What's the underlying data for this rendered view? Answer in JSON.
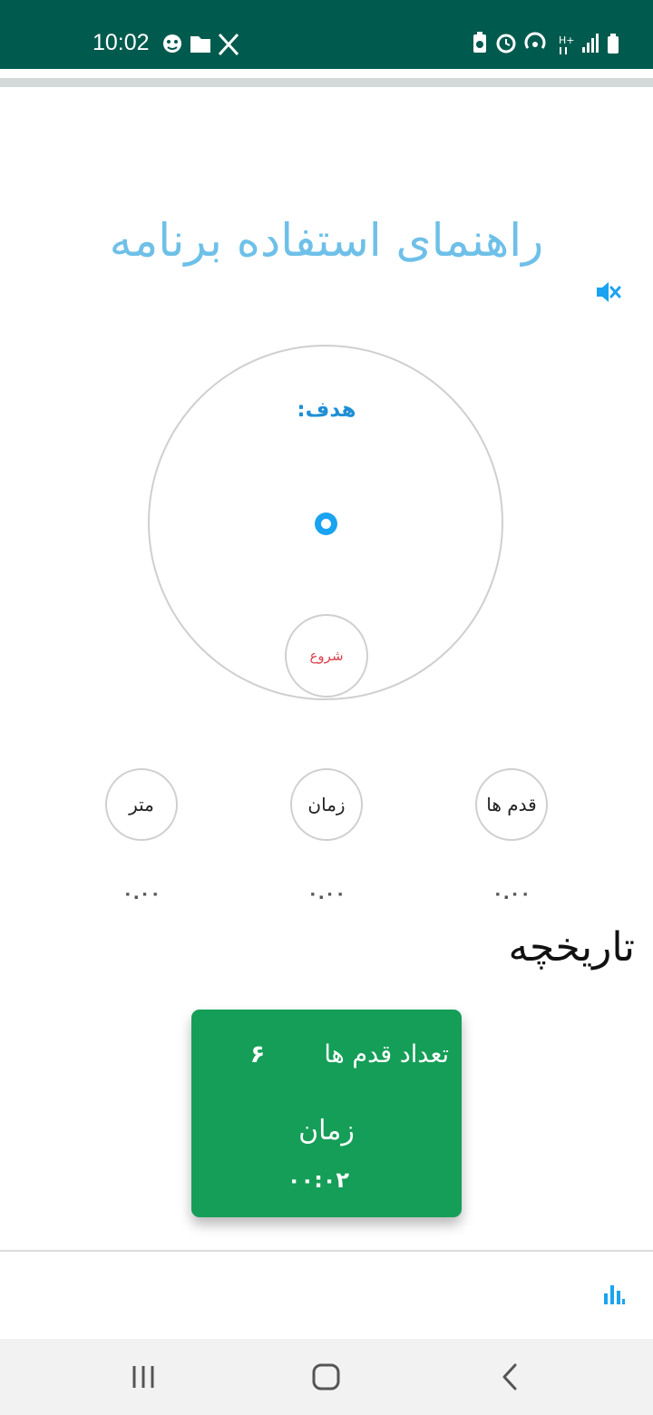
{
  "status_bar": {
    "time": "10:02",
    "background": "#005a4e",
    "left_icons": [
      "face-emoji-icon",
      "folder-icon",
      "x-logo-icon"
    ],
    "right_icons": [
      "battery-saver-icon",
      "alarm-icon",
      "hotspot-icon",
      "hplus-data-icon",
      "signal-icon",
      "battery-icon"
    ]
  },
  "header": {
    "help_title": "راهنمای استفاده برنامه",
    "title_color": "#6ec0e8",
    "mute_icon": "volume-mute-icon"
  },
  "tracker": {
    "goal_label": "هدف:",
    "start_label": "شروع",
    "accent_color": "#1aa3f0",
    "start_color": "#d9434b"
  },
  "stats": [
    {
      "label": "قدم ها",
      "value": "۰.۰۰"
    },
    {
      "label": "زمان",
      "value": "۰.۰۰"
    },
    {
      "label": "متر",
      "value": "۰.۰۰"
    }
  ],
  "history": {
    "title": "تاریخچه",
    "card": {
      "steps_label": "تعداد قدم ها",
      "steps_value": "۶",
      "time_label": "زمان",
      "time_value": "۰۰:۰۲",
      "background": "#159e57"
    }
  },
  "bottom_bar": {
    "stats_icon": "bar-chart-icon"
  },
  "nav_bar": {
    "buttons": [
      "recent-apps-icon",
      "home-icon",
      "back-icon"
    ]
  }
}
